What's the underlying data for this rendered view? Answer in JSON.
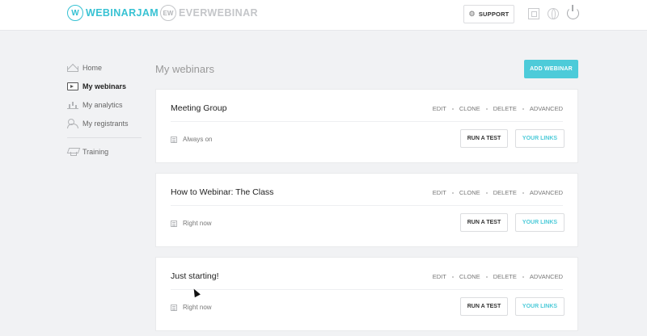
{
  "header": {
    "brand_primary": "WEBINARJAM",
    "brand_primary_mark": "W",
    "brand_secondary": "EVERWEBINAR",
    "brand_secondary_mark": "EW",
    "support_label": "SUPPORT",
    "icons": [
      "grid-icon",
      "globe-icon",
      "power-icon"
    ]
  },
  "sidebar": {
    "items": [
      {
        "label": "Home",
        "icon": "home-icon",
        "active": false
      },
      {
        "label": "My webinars",
        "icon": "webinar-icon",
        "active": true
      },
      {
        "label": "My analytics",
        "icon": "analytics-icon",
        "active": false
      },
      {
        "label": "My registrants",
        "icon": "registrants-icon",
        "active": false
      }
    ],
    "secondary": [
      {
        "label": "Training",
        "icon": "training-icon"
      }
    ]
  },
  "main": {
    "title": "My webinars",
    "add_button": "ADD WEBINAR",
    "webinars": [
      {
        "title": "Meeting Group",
        "schedule": "Always on"
      },
      {
        "title": "How to Webinar: The Class",
        "schedule": "Right now"
      },
      {
        "title": "Just starting!",
        "schedule": "Right now"
      }
    ],
    "card_actions": {
      "edit": "EDIT",
      "clone": "CLONE",
      "delete": "DELETE",
      "advanced": "ADVANCED"
    },
    "run_test_label": "RUN A TEST",
    "your_links_label": "YOUR LINKS"
  },
  "colors": {
    "accent": "#4dcbd9",
    "brand": "#37c2d3",
    "background": "#f1f2f4"
  }
}
